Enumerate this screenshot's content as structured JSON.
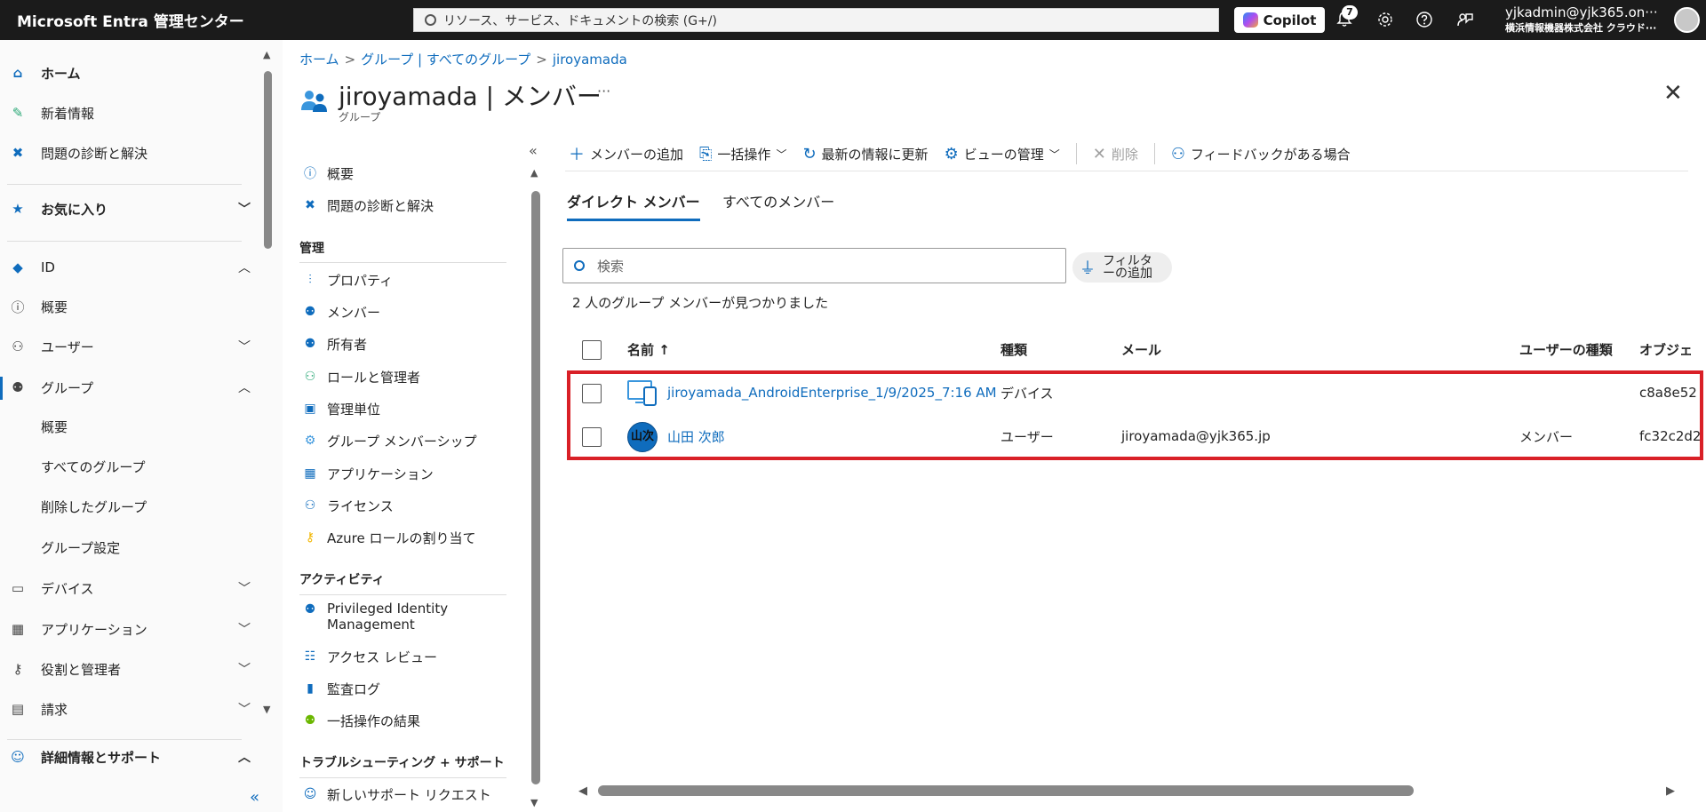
{
  "topbar": {
    "brand": "Microsoft Entra 管理センター",
    "search_placeholder": "リソース、サービス、ドキュメントの検索 (G+/)",
    "copilot_label": "Copilot",
    "notification_count": "7",
    "account_user": "yjkadmin@yjk365.on···",
    "account_org": "横浜情報機器株式会社  クラウド···"
  },
  "leftnav": {
    "home": "ホーム",
    "whats_new": "新着情報",
    "diagnose": "問題の診断と解決",
    "favorites": "お気に入り",
    "identity": "ID",
    "overview": "概要",
    "users": "ユーザー",
    "groups": "グループ",
    "groups_overview": "概要",
    "all_groups": "すべてのグループ",
    "deleted_groups": "削除したグループ",
    "group_settings": "グループ設定",
    "devices": "デバイス",
    "applications": "アプリケーション",
    "roles_admins": "役割と管理者",
    "billing": "請求",
    "learn_support": "詳細情報とサポート"
  },
  "breadcrumb": {
    "home": "ホーム",
    "groups": "グループ | すべてのグループ",
    "current": "jiroyamada"
  },
  "header": {
    "title": "jiroyamada | メンバー",
    "subtitle": "グループ",
    "more": "···"
  },
  "resmenu": {
    "overview": "概要",
    "diagnose": "問題の診断と解決",
    "manage_head": "管理",
    "properties": "プロパティ",
    "members": "メンバー",
    "owners": "所有者",
    "roles_admins": "ロールと管理者",
    "admin_units": "管理単位",
    "group_memberships": "グループ メンバーシップ",
    "applications": "アプリケーション",
    "licenses": "ライセンス",
    "azure_roles": "Azure ロールの割り当て",
    "activity_head": "アクティビティ",
    "pim": "Privileged Identity Management",
    "access_reviews": "アクセス レビュー",
    "audit_logs": "監査ログ",
    "bulk_results": "一括操作の結果",
    "trouble_head": "トラブルシューティング + サポート",
    "new_support": "新しいサポート リクエスト"
  },
  "toolbar": {
    "add_members": "メンバーの追加",
    "bulk_ops": "一括操作",
    "refresh": "最新の情報に更新",
    "manage_view": "ビューの管理",
    "delete": "削除",
    "feedback": "フィードバックがある場合"
  },
  "tabs": {
    "direct": "ダイレクト メンバー",
    "all": "すべてのメンバー"
  },
  "filter": {
    "search_placeholder": "検索",
    "add_filter": "フィルターの追加"
  },
  "result_count": "2 人のグループ メンバーが見つかりました",
  "table": {
    "headers": {
      "name": "名前 ↑",
      "type": "種類",
      "mail": "メール",
      "user_type": "ユーザーの種類",
      "object": "オブジェ"
    },
    "rows": [
      {
        "name": "jiroyamada_AndroidEnterprise_1/9/2025_7:16 AM",
        "type": "デバイス",
        "mail": "",
        "user_type": "",
        "object_id": "c8a8e52"
      },
      {
        "avatar": "山次",
        "name": "山田 次郎",
        "type": "ユーザー",
        "mail": "jiroyamada@yjk365.jp",
        "user_type": "メンバー",
        "object_id": "fc32c2d2"
      }
    ]
  },
  "colors": {
    "accent": "#0f6cbd",
    "highlight": "#d92027",
    "topbar": "#1b1b1b"
  }
}
